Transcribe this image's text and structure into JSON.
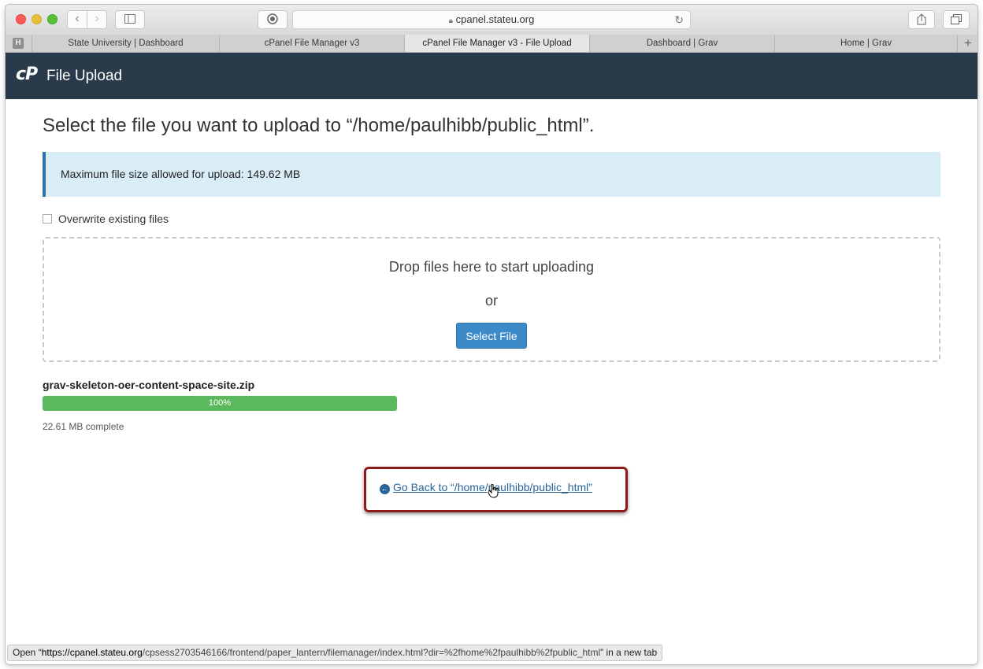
{
  "browser": {
    "address": "cpanel.stateu.org",
    "pinned_tab": "H",
    "tabs": [
      {
        "label": "State University | Dashboard"
      },
      {
        "label": "cPanel File Manager v3"
      },
      {
        "label": "cPanel File Manager v3 - File Upload"
      },
      {
        "label": "Dashboard | Grav"
      },
      {
        "label": "Home | Grav"
      }
    ],
    "status_prefix": "Open “",
    "status_url_host": "https://cpanel.stateu.org",
    "status_url_path": "/cpsess2703546166/frontend/paper_lantern/filemanager/index.html?dir=%2fhome%2fpaulhibb%2fpublic_html",
    "status_suffix": "” in a new tab"
  },
  "header": {
    "logo": "cP",
    "title": "File Upload"
  },
  "main": {
    "page_title": "Select the file you want to upload to “/home/paulhibb/public_html”.",
    "max_size_text": "Maximum file size allowed for upload: 149.62 MB",
    "overwrite_label": "Overwrite existing files",
    "overwrite_checked": false,
    "drop_text": "Drop files here to start uploading",
    "or_text": "or",
    "select_file_label": "Select File",
    "upload": {
      "file_name": "grav-skeleton-oer-content-space-site.zip",
      "progress_percent": 100,
      "progress_label": "100%",
      "complete_text": "22.61 MB complete"
    },
    "go_back_label": "Go Back to “/home/paulhibb/public_html”"
  },
  "colors": {
    "header_bg": "#293a4a",
    "alert_bg": "#d9edf7",
    "progress_fill": "#5cb85c",
    "button_primary": "#3d8ac9",
    "highlight_border": "#8b1a1a"
  },
  "icons": {
    "go_back": "arrow-circle-left-icon",
    "reload": "reload-icon",
    "lock": "lock-icon",
    "share": "share-icon",
    "tabs": "tabs-overview-icon",
    "sidebar": "sidebar-icon",
    "reader": "reader-icon"
  }
}
